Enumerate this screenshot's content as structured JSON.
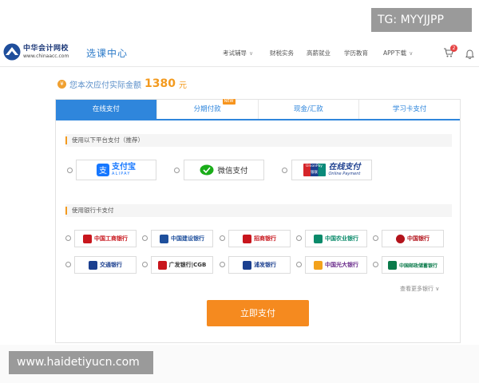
{
  "header": {
    "logo_cn": "中华会计网校",
    "logo_url": "www.chinaacc.com",
    "site_title": "选课中心",
    "nav": [
      {
        "label": "考试辅导",
        "dropdown": true
      },
      {
        "label": "财税实务",
        "dropdown": false
      },
      {
        "label": "高薪就业",
        "dropdown": false
      },
      {
        "label": "学历教育",
        "dropdown": false
      },
      {
        "label": "APP下载",
        "dropdown": true
      }
    ],
    "cart_count": "2",
    "icons": {
      "cart": "cart-icon",
      "bell": "bell-icon",
      "chevron": "chevron-down-icon"
    }
  },
  "watermark_top": "TG: MYYJJPP",
  "watermark_bottom": "www.haidetiyucn.com",
  "amount": {
    "prefix": "您本次应付实际金额",
    "value": "1380",
    "unit": "元"
  },
  "tabs": [
    {
      "label": "在线支付",
      "active": true
    },
    {
      "label": "分期付款",
      "badge": "NEW"
    },
    {
      "label": "现金/汇款"
    },
    {
      "label": "学习卡支付"
    }
  ],
  "platform_section": {
    "title": "使用以下平台支付（推荐）",
    "options": [
      {
        "name": "支付宝",
        "sub": "ALIPAY",
        "color": "#1677ff"
      },
      {
        "name": "微信支付",
        "color": "#1aad19"
      },
      {
        "name": "在线支付",
        "sub": "Online Payment",
        "badge": "UnionPay 银联",
        "color": "#1d3f8f"
      }
    ]
  },
  "bank_section": {
    "title": "使用银行卡支付",
    "banks": [
      {
        "name": "中国工商银行",
        "color": "#c8161d"
      },
      {
        "name": "中国建设银行",
        "color": "#1e4f9c"
      },
      {
        "name": "招商银行",
        "color": "#c8161d"
      },
      {
        "name": "中国农业银行",
        "color": "#0a8a6a"
      },
      {
        "name": "中国银行",
        "color": "#b3131b"
      },
      {
        "name": "交通银行",
        "color": "#1b3f8f"
      },
      {
        "name": "广发银行|CGB",
        "color": "#c8161d"
      },
      {
        "name": "浦发银行",
        "color": "#1b3f8f"
      },
      {
        "name": "中国光大银行",
        "color": "#6b2d8c"
      },
      {
        "name": "中国邮政储蓄银行",
        "color": "#0a7a4a"
      }
    ],
    "more_label": "查看更多银行"
  },
  "submit_label": "立即支付",
  "colors": {
    "accent": "#2f86dc",
    "orange": "#f58a1f"
  }
}
